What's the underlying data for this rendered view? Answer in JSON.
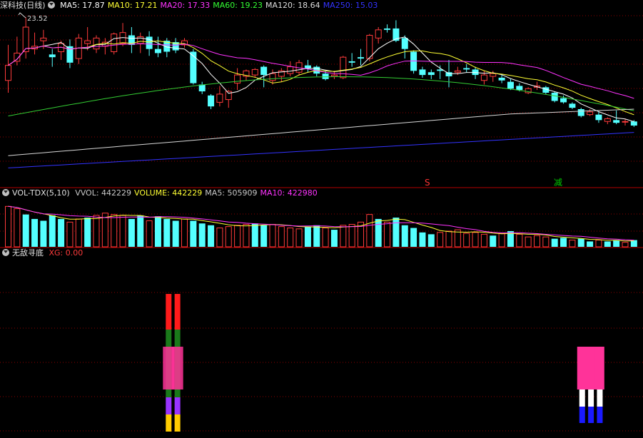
{
  "main": {
    "title": "深科技(日线)",
    "ma": [
      {
        "label": "MA5: 17.87",
        "color": "#ffffff"
      },
      {
        "label": "MA10: 17.21",
        "color": "#ffff33"
      },
      {
        "label": "MA20: 17.33",
        "color": "#ff33ff"
      },
      {
        "label": "MA60: 19.23",
        "color": "#33ff33"
      },
      {
        "label": "MA120: 18.64",
        "color": "#dddddd"
      },
      {
        "label": "MA250: 15.03",
        "color": "#3333ff"
      }
    ],
    "high_label": "23.52",
    "sell_mark": "S",
    "reduce_mark": "减",
    "candles": [
      [
        18.9,
        20.0,
        21.5,
        18.0
      ],
      [
        20.3,
        20.9,
        22.1,
        20.0
      ],
      [
        21.0,
        22.8,
        23.52,
        20.5
      ],
      [
        21.2,
        21.4,
        22.4,
        20.8
      ],
      [
        21.8,
        22.0,
        22.6,
        21.2
      ],
      [
        20.8,
        20.6,
        21.2,
        19.9
      ],
      [
        21.0,
        21.6,
        21.8,
        20.4
      ],
      [
        21.4,
        20.2,
        21.9,
        19.8
      ],
      [
        20.5,
        22.0,
        22.3,
        20.1
      ],
      [
        21.6,
        21.8,
        22.8,
        21.1
      ],
      [
        21.2,
        22.0,
        22.2,
        20.9
      ],
      [
        21.4,
        21.7,
        22.0,
        20.8
      ],
      [
        21.0,
        22.3,
        22.4,
        20.8
      ],
      [
        21.6,
        22.4,
        23.1,
        21.4
      ],
      [
        22.2,
        21.5,
        22.8,
        20.9
      ],
      [
        21.6,
        22.1,
        22.4,
        20.9
      ],
      [
        22.1,
        21.2,
        22.5,
        20.7
      ],
      [
        21.2,
        20.9,
        22.1,
        20.6
      ],
      [
        21.8,
        21.0,
        22.0,
        20.6
      ],
      [
        21.7,
        21.1,
        22.0,
        20.9
      ],
      [
        21.5,
        21.8,
        22.0,
        21.3
      ],
      [
        21.0,
        18.7,
        21.2,
        18.6
      ],
      [
        18.6,
        18.1,
        18.8,
        17.9
      ],
      [
        17.8,
        17.0,
        17.9,
        16.8
      ],
      [
        17.3,
        17.9,
        18.5,
        17.0
      ],
      [
        17.5,
        18.1,
        18.2,
        16.9
      ],
      [
        18.7,
        19.3,
        19.8,
        18.2
      ],
      [
        19.2,
        19.6,
        19.7,
        18.9
      ],
      [
        19.3,
        19.7,
        19.8,
        19.1
      ],
      [
        19.9,
        19.3,
        20.0,
        18.4
      ],
      [
        18.9,
        19.4,
        19.7,
        18.6
      ],
      [
        19.2,
        19.6,
        19.8,
        18.8
      ],
      [
        19.4,
        19.9,
        20.3,
        19.2
      ],
      [
        19.5,
        20.2,
        20.4,
        19.3
      ],
      [
        20.0,
        19.8,
        20.4,
        19.5
      ],
      [
        19.9,
        19.4,
        20.0,
        19.2
      ],
      [
        19.4,
        19.0,
        19.6,
        18.9
      ],
      [
        19.2,
        19.3,
        19.6,
        19.0
      ],
      [
        19.1,
        20.6,
        20.7,
        19.0
      ],
      [
        20.3,
        20.2,
        20.9,
        19.9
      ],
      [
        20.6,
        20.5,
        21.2,
        20.0
      ],
      [
        20.5,
        22.2,
        22.3,
        20.3
      ],
      [
        22.0,
        22.6,
        22.8,
        21.6
      ],
      [
        22.7,
        22.6,
        23.0,
        22.4
      ],
      [
        22.7,
        21.8,
        23.3,
        21.7
      ],
      [
        22.0,
        21.2,
        22.2,
        20.5
      ],
      [
        21.0,
        19.6,
        21.1,
        19.4
      ],
      [
        19.7,
        19.3,
        19.9,
        19.1
      ],
      [
        19.5,
        19.3,
        19.7,
        19.0
      ],
      [
        19.7,
        19.6,
        20.0,
        19.0
      ],
      [
        19.5,
        19.2,
        20.4,
        18.4
      ],
      [
        19.5,
        19.6,
        19.9,
        19.3
      ],
      [
        19.8,
        19.7,
        20.1,
        19.5
      ],
      [
        19.7,
        19.3,
        19.9,
        19.0
      ],
      [
        18.9,
        19.3,
        19.6,
        18.6
      ],
      [
        19.2,
        19.4,
        19.6,
        18.8
      ],
      [
        19.1,
        18.9,
        19.3,
        18.7
      ],
      [
        18.8,
        18.3,
        19.0,
        18.2
      ],
      [
        18.5,
        18.2,
        18.7,
        18.1
      ],
      [
        18.0,
        18.3,
        18.4,
        17.9
      ],
      [
        18.4,
        18.5,
        18.8,
        18.2
      ],
      [
        18.4,
        18.0,
        18.5,
        17.9
      ],
      [
        18.0,
        17.4,
        18.1,
        17.3
      ],
      [
        17.6,
        17.3,
        17.8,
        17.2
      ],
      [
        17.2,
        16.9,
        17.3,
        16.8
      ],
      [
        16.8,
        16.3,
        16.9,
        16.2
      ],
      [
        16.4,
        16.6,
        16.8,
        16.3
      ],
      [
        16.4,
        16.0,
        16.6,
        15.8
      ],
      [
        15.9,
        16.1,
        16.2,
        15.7
      ],
      [
        16.0,
        15.8,
        16.7,
        15.7
      ],
      [
        15.9,
        15.9,
        16.1,
        15.6
      ],
      [
        15.9,
        15.6,
        16.0,
        15.5
      ]
    ]
  },
  "vol": {
    "title": "VOL-TDX(5,10)",
    "labels": [
      {
        "label": "VVOL: 442229",
        "color": "#c8c8c8"
      },
      {
        "label": "VOLUME: 442229",
        "color": "#ffff33"
      },
      {
        "label": "MA5: 505909",
        "color": "#c8c8c8"
      },
      {
        "label": "MA10: 422980",
        "color": "#ff33ff"
      }
    ],
    "bars": [
      [
        90,
        1
      ],
      [
        85,
        1
      ],
      [
        72,
        0
      ],
      [
        62,
        0
      ],
      [
        58,
        0
      ],
      [
        70,
        0
      ],
      [
        62,
        0
      ],
      [
        55,
        1
      ],
      [
        62,
        1
      ],
      [
        65,
        0
      ],
      [
        70,
        1
      ],
      [
        75,
        1
      ],
      [
        72,
        1
      ],
      [
        70,
        1
      ],
      [
        62,
        0
      ],
      [
        70,
        0
      ],
      [
        58,
        1
      ],
      [
        68,
        0
      ],
      [
        62,
        0
      ],
      [
        58,
        0
      ],
      [
        62,
        1
      ],
      [
        58,
        0
      ],
      [
        52,
        0
      ],
      [
        48,
        0
      ],
      [
        42,
        1
      ],
      [
        45,
        1
      ],
      [
        48,
        1
      ],
      [
        50,
        1
      ],
      [
        52,
        0
      ],
      [
        48,
        0
      ],
      [
        50,
        1
      ],
      [
        45,
        1
      ],
      [
        42,
        1
      ],
      [
        40,
        1
      ],
      [
        45,
        0
      ],
      [
        48,
        0
      ],
      [
        42,
        1
      ],
      [
        38,
        0
      ],
      [
        48,
        1
      ],
      [
        50,
        1
      ],
      [
        55,
        1
      ],
      [
        72,
        1
      ],
      [
        62,
        0
      ],
      [
        55,
        1
      ],
      [
        65,
        0
      ],
      [
        48,
        0
      ],
      [
        42,
        0
      ],
      [
        32,
        0
      ],
      [
        28,
        0
      ],
      [
        32,
        1
      ],
      [
        35,
        1
      ],
      [
        38,
        1
      ],
      [
        30,
        1
      ],
      [
        32,
        1
      ],
      [
        28,
        1
      ],
      [
        25,
        0
      ],
      [
        30,
        1
      ],
      [
        35,
        0
      ],
      [
        28,
        1
      ],
      [
        22,
        1
      ],
      [
        25,
        1
      ],
      [
        22,
        1
      ],
      [
        18,
        0
      ],
      [
        20,
        0
      ],
      [
        15,
        1
      ],
      [
        18,
        0
      ],
      [
        12,
        0
      ],
      [
        15,
        1
      ],
      [
        12,
        0
      ],
      [
        15,
        0
      ],
      [
        10,
        1
      ],
      [
        15,
        0
      ]
    ],
    "scale_max": 100
  },
  "ind": {
    "title": "无敌寻底",
    "xg_label": "XG: 0.00",
    "signals": [
      {
        "index": 18,
        "type": "tower"
      },
      {
        "index": 19,
        "type": "tower"
      },
      {
        "index": 65,
        "type": "pink"
      },
      {
        "index": 66,
        "type": "pink"
      },
      {
        "index": 67,
        "type": "pink"
      }
    ]
  },
  "colors": {
    "up": "#ff3b3b",
    "down": "#54ffff",
    "grid": "#8b0000",
    "divider": "#b30000",
    "ma5": "#ffffff",
    "ma10": "#ffff33",
    "ma20": "#ff33ff",
    "ma60": "#33cc33",
    "ma120": "#d8d8d8",
    "ma250": "#3333ff",
    "sig_red": "#ff1a1a",
    "sig_green": "#1a7a1a",
    "sig_pink": "#ff3399",
    "sig_purple": "#9933ff",
    "sig_orange": "#ffcc00",
    "sig_white": "#ffffff",
    "sig_blue": "#1a1aff"
  }
}
